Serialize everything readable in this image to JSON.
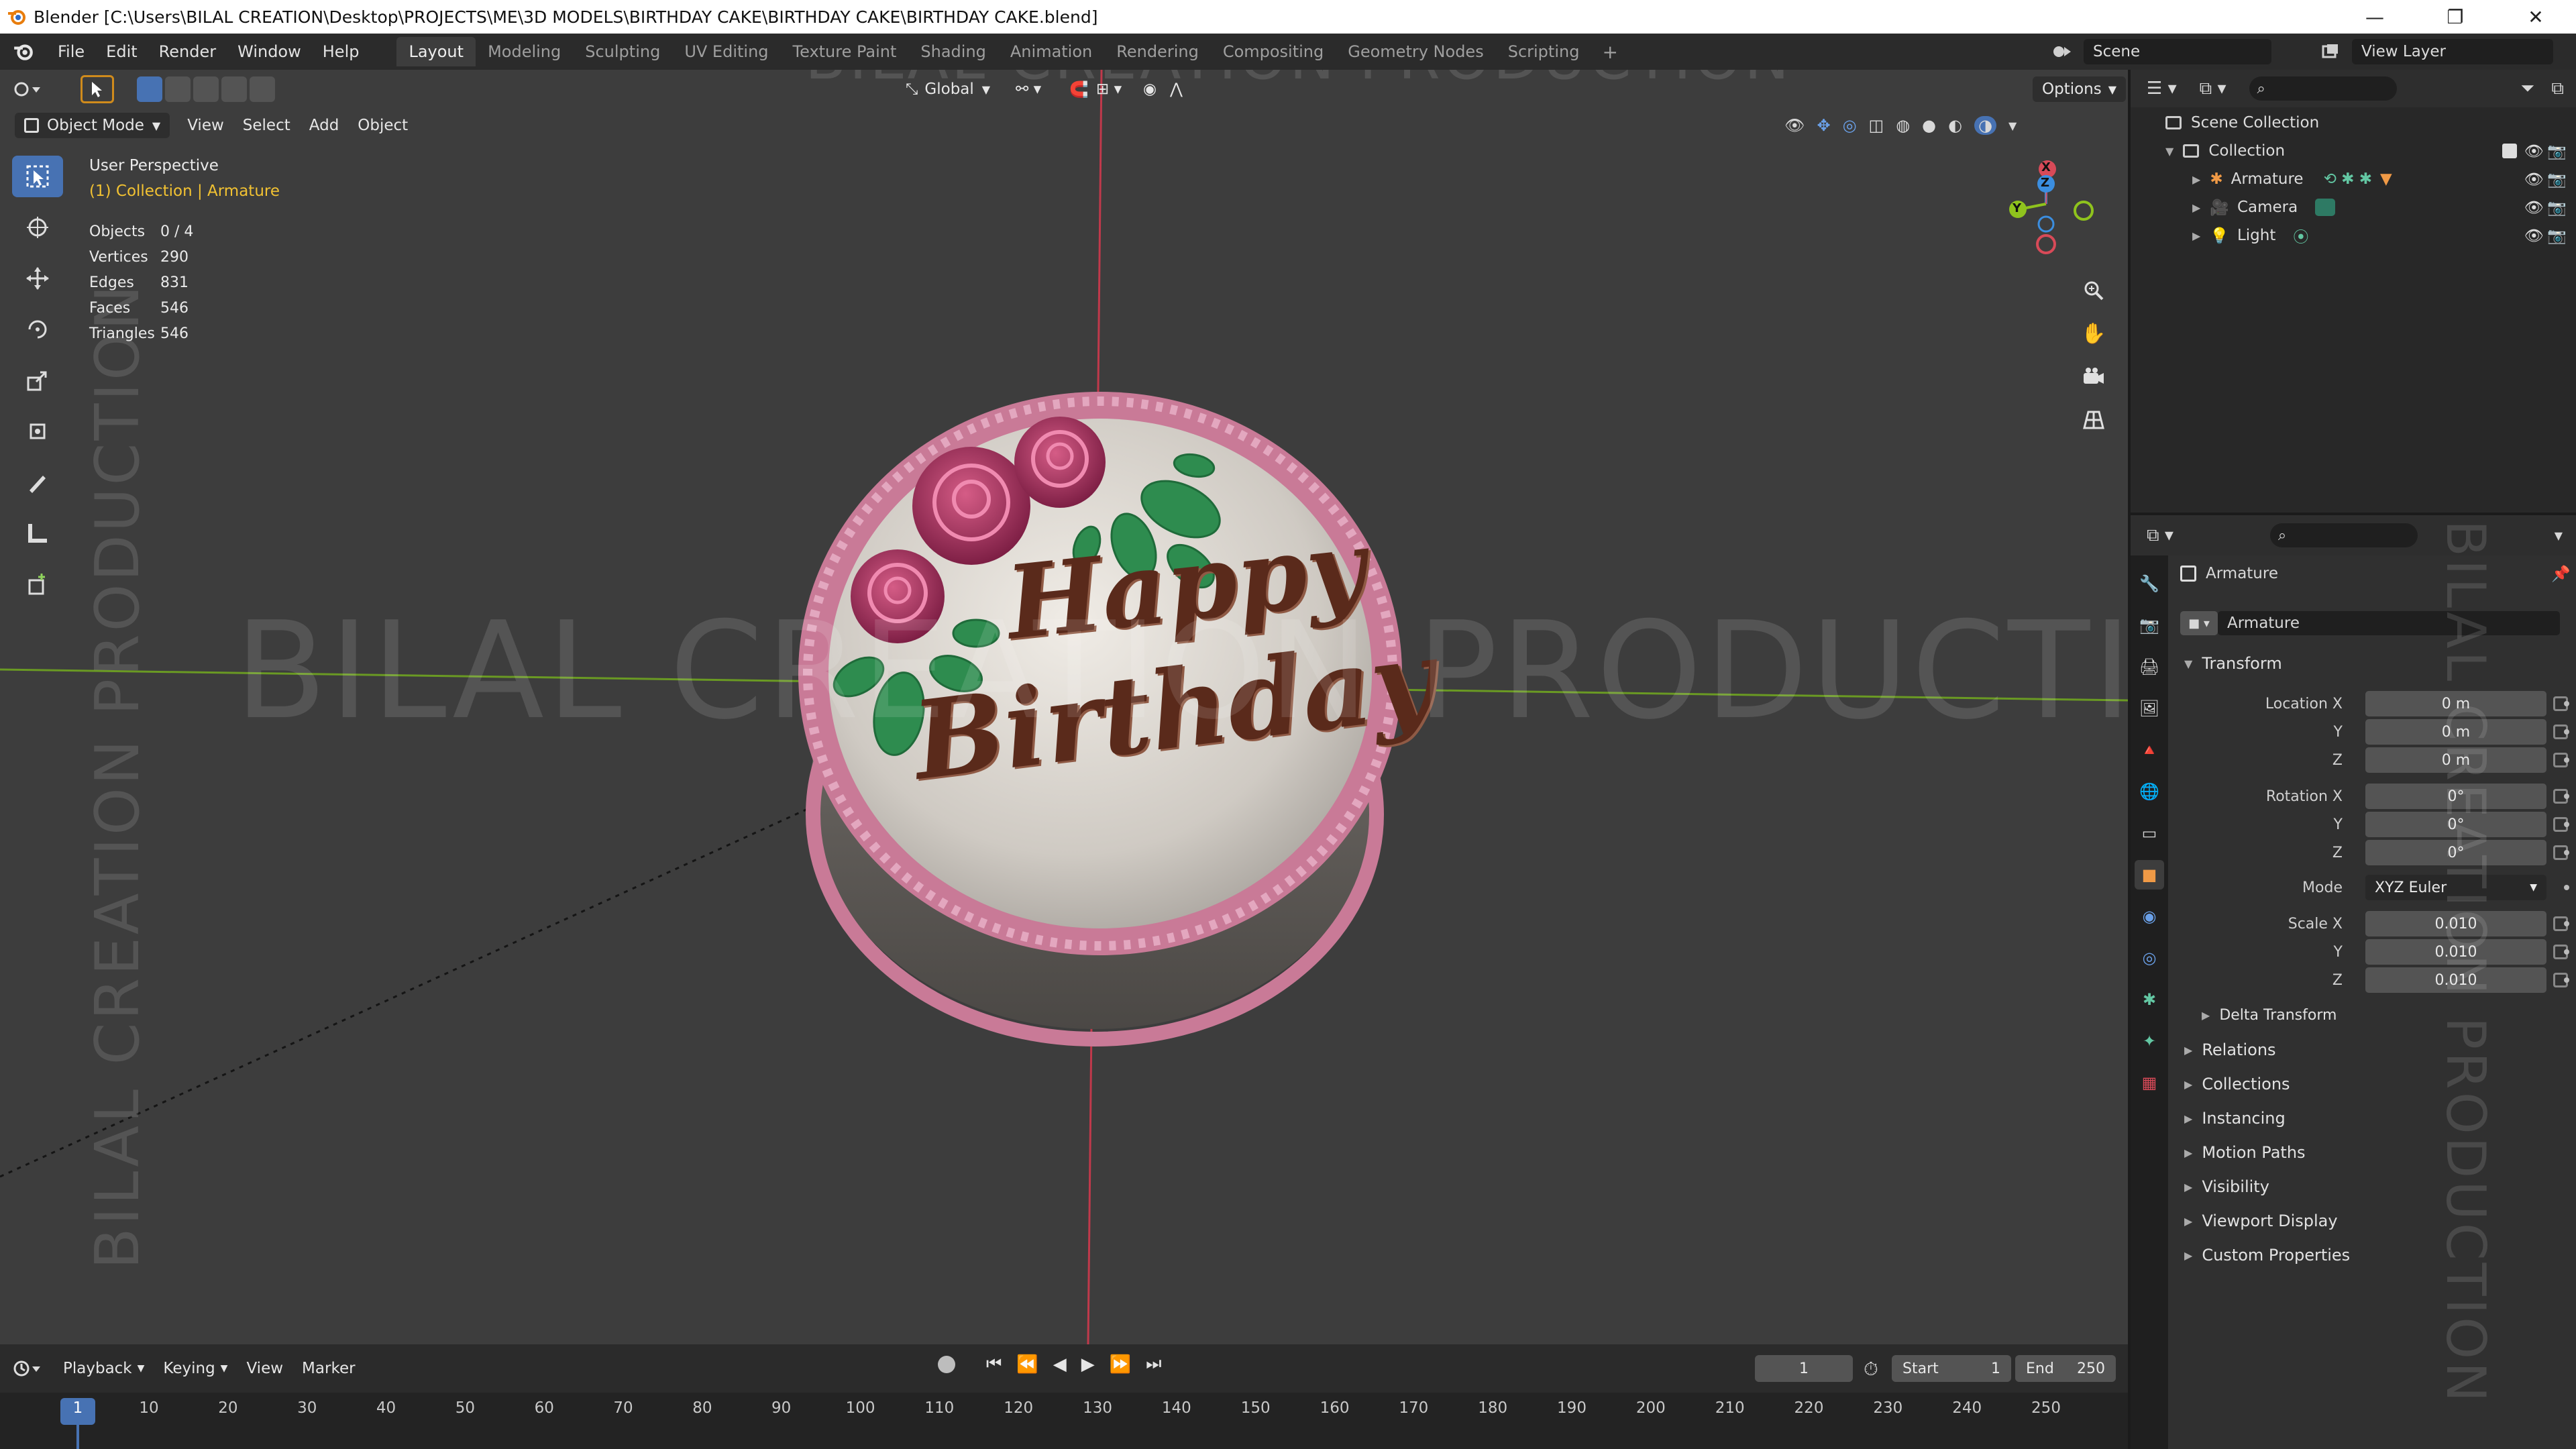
{
  "window": {
    "title": "Blender [C:\\Users\\BILAL CREATION\\Desktop\\PROJECTS\\ME\\3D MODELS\\BIRTHDAY CAKE\\BIRTHDAY CAKE\\BIRTHDAY CAKE.blend]",
    "controls": [
      "—",
      "❐",
      "✕"
    ]
  },
  "menu": [
    "File",
    "Edit",
    "Render",
    "Window",
    "Help"
  ],
  "workspaces": [
    "Layout",
    "Modeling",
    "Sculpting",
    "UV Editing",
    "Texture Paint",
    "Shading",
    "Animation",
    "Rendering",
    "Compositing",
    "Geometry Nodes",
    "Scripting"
  ],
  "active_workspace": "Layout",
  "scene": "Scene",
  "view_layer": "View Layer",
  "viewport": {
    "mode": "Object Mode",
    "menus": [
      "View",
      "Select",
      "Add",
      "Object"
    ],
    "orientation": "Global",
    "options_label": "Options",
    "view_name": "User Perspective",
    "collection_info": "(1) Collection | Armature",
    "stats": [
      {
        "label": "Objects",
        "value": "0 / 4"
      },
      {
        "label": "Vertices",
        "value": "290"
      },
      {
        "label": "Edges",
        "value": "831"
      },
      {
        "label": "Faces",
        "value": "546"
      },
      {
        "label": "Triangles",
        "value": "546"
      }
    ],
    "cake_text_line1": "Happy",
    "cake_text_line2": "Birthday",
    "gizmo": {
      "x": "X",
      "y": "Y",
      "z": "Z"
    },
    "watermark": "BILAL CREATION PRODUCTION"
  },
  "timeline": {
    "menus": [
      "Playback",
      "Keying",
      "View",
      "Marker"
    ],
    "current_frame": "1",
    "start_label": "Start",
    "start": "1",
    "end_label": "End",
    "end": "250",
    "ticks": [
      "1",
      "10",
      "20",
      "30",
      "40",
      "50",
      "60",
      "70",
      "80",
      "90",
      "100",
      "110",
      "120",
      "130",
      "140",
      "150",
      "160",
      "170",
      "180",
      "190",
      "200",
      "210",
      "220",
      "230",
      "240",
      "250"
    ]
  },
  "outliner": {
    "root": "Scene Collection",
    "collection": "Collection",
    "items": [
      "Armature",
      "Camera",
      "Light"
    ]
  },
  "properties": {
    "object_name": "Armature",
    "data_name": "Armature",
    "transform_label": "Transform",
    "location": {
      "label": "Location X",
      "x": "0 m",
      "y": "0 m",
      "z": "0 m"
    },
    "rotation": {
      "label": "Rotation X",
      "x": "0°",
      "y": "0°",
      "z": "0°"
    },
    "mode_label": "Mode",
    "mode_value": "XYZ Euler",
    "scale": {
      "label": "Scale X",
      "x": "0.010",
      "y": "0.010",
      "z": "0.010"
    },
    "axis_y": "Y",
    "axis_z": "Z",
    "delta": "Delta Transform",
    "sections": [
      "Relations",
      "Collections",
      "Instancing",
      "Motion Paths",
      "Visibility",
      "Viewport Display",
      "Custom Properties"
    ]
  },
  "colors": {
    "accent": "#4772b3",
    "frosting": "#d9d5cf",
    "border_pink": "#c97a97",
    "rose": "#a9355f",
    "leaf": "#2e8c4f",
    "chocolate": "#5a2a1b",
    "axis_red": "#c0394b",
    "axis_green": "#6a9a23"
  }
}
